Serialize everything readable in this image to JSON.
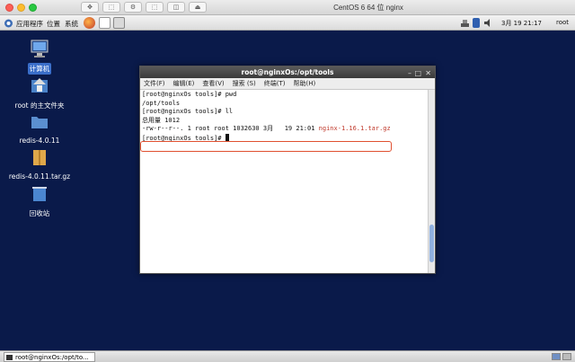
{
  "host": {
    "title": "CentOS 6 64 位 nginx",
    "toolbar_glyphs": [
      "✥",
      "⬚",
      "⚙",
      "⬚",
      "◫",
      "⏏"
    ]
  },
  "panel": {
    "menus": [
      "应用程序",
      "位置",
      "系统"
    ],
    "clock": "3月 19 21:17",
    "user": "root"
  },
  "desktop": {
    "icons": [
      {
        "label": "计算机"
      },
      {
        "label": "root 的主文件夹"
      },
      {
        "label": "redis-4.0.11"
      },
      {
        "label": "redis-4.0.11.tar.gz"
      },
      {
        "label": "回收站"
      }
    ]
  },
  "terminal": {
    "title": "root@nginxOs:/opt/tools",
    "menus": [
      "文件(F)",
      "编辑(E)",
      "查看(V)",
      "搜索 (S)",
      "终端(T)",
      "帮助(H)"
    ],
    "lines": [
      "[root@nginxOs tools]# pwd",
      "/opt/tools",
      "[root@nginxOs tools]# ll",
      "总用量 1012"
    ],
    "ls_line": {
      "perm": "-rw-r--r--. 1 root root 1032630 3月   19 21:01 ",
      "file": "nginx-1.16.1.tar.gz"
    },
    "prompt": "[root@nginxOs tools]# "
  },
  "taskbar": {
    "item": "root@nginxOs:/opt/to..."
  },
  "colors": {
    "desktop_bg": "#0a1a4a",
    "highlight": "#e05030",
    "filename": "#c0392b"
  }
}
